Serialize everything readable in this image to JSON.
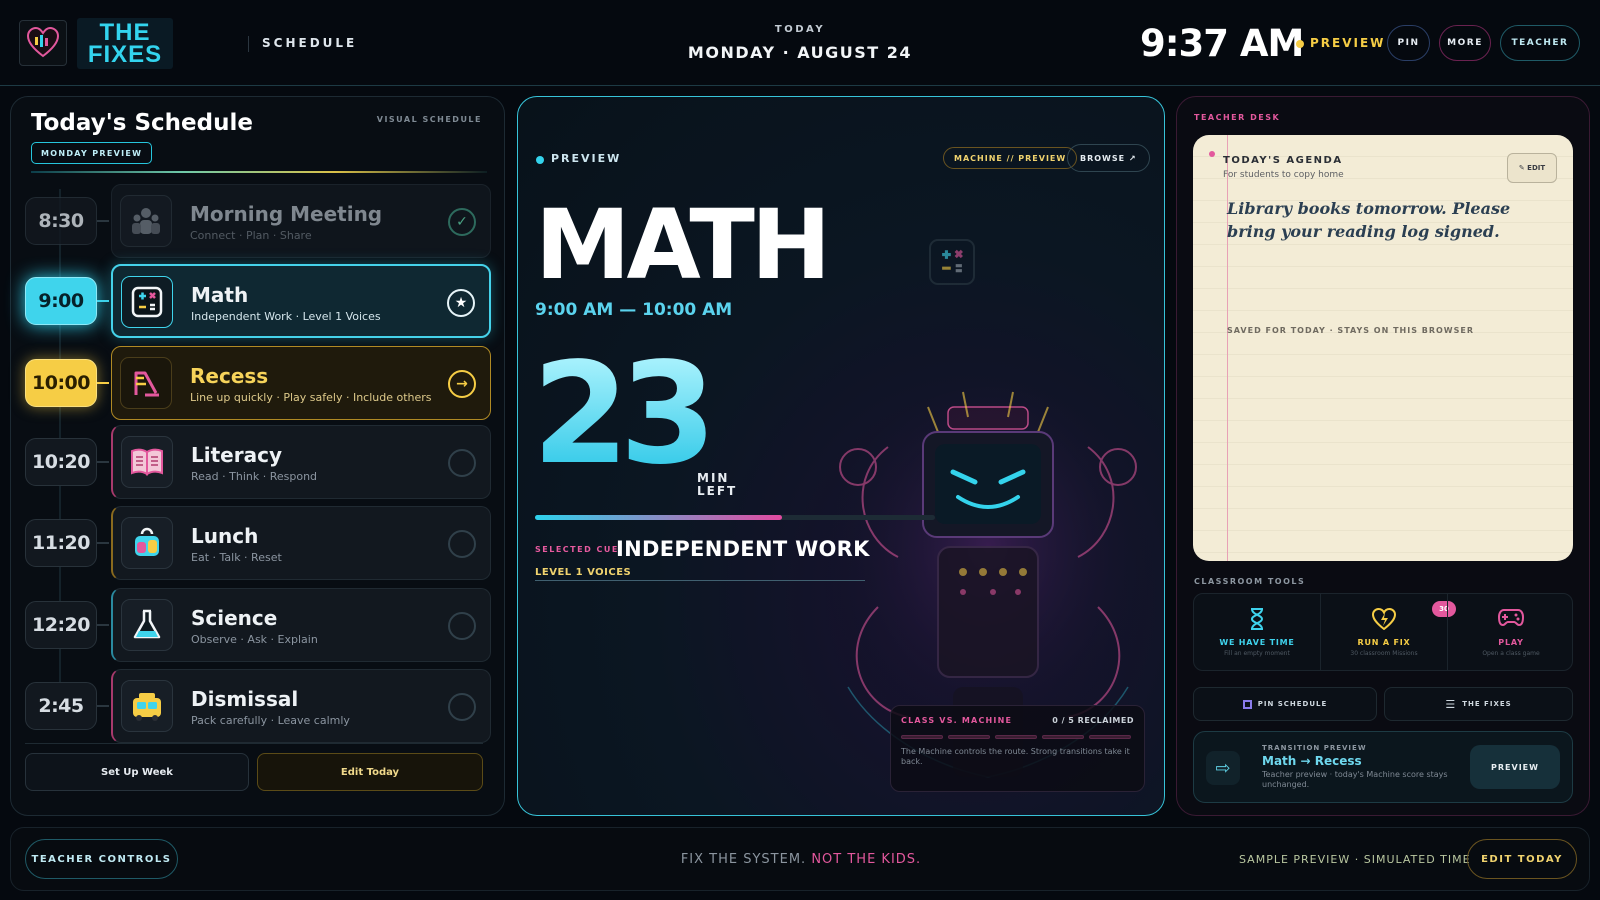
{
  "header": {
    "logo_line1": "THE",
    "logo_line2": "FIXES",
    "section": "SCHEDULE",
    "today_label": "TODAY",
    "date": "MONDAY · AUGUST 24",
    "clock": "9:37 AM",
    "preview_label": "PREVIEW",
    "buttons": {
      "pin": "PIN",
      "more": "MORE",
      "teacher": "TEACHER"
    }
  },
  "schedule": {
    "title": "Today's Schedule",
    "visual_label": "VISUAL SCHEDULE",
    "badge": "MONDAY PREVIEW",
    "items": [
      {
        "time": "8:30",
        "name": "Morning Meeting",
        "sub": "Connect · Plan · Share",
        "state": "done",
        "mark": "✓",
        "icon": "people-icon"
      },
      {
        "time": "9:00",
        "name": "Math",
        "sub": "Independent Work · Level 1 Voices",
        "state": "current",
        "mark": "★",
        "icon": "calculator-icon"
      },
      {
        "time": "10:00",
        "name": "Recess",
        "sub": "Line up quickly · Play safely · Include others",
        "state": "next",
        "mark": "→",
        "icon": "slide-icon"
      },
      {
        "time": "10:20",
        "name": "Literacy",
        "sub": "Read · Think · Respond",
        "state": "upcoming",
        "mark": "",
        "icon": "book-icon"
      },
      {
        "time": "11:20",
        "name": "Lunch",
        "sub": "Eat · Talk · Reset",
        "state": "upcoming",
        "mark": "",
        "icon": "lunchbox-icon"
      },
      {
        "time": "12:20",
        "name": "Science",
        "sub": "Observe · Ask · Explain",
        "state": "upcoming",
        "mark": "",
        "icon": "flask-icon"
      },
      {
        "time": "2:45",
        "name": "Dismissal",
        "sub": "Pack carefully · Leave calmly",
        "state": "upcoming",
        "mark": "",
        "icon": "bus-icon"
      }
    ],
    "setup_week": "Set Up Week",
    "edit_today": "Edit Today"
  },
  "current": {
    "preview_label": "PREVIEW",
    "machine_badge": "MACHINE // PREVIEW",
    "browse": "BROWSE ↗",
    "subject": "MATH",
    "time_range": "9:00 AM — 10:00 AM",
    "minutes_left": "23",
    "min_label_1": "MIN",
    "min_label_2": "LEFT",
    "progress_fraction": 0.617,
    "cue_label": "SELECTED CUE",
    "cue": "INDEPENDENT WORK",
    "voice_level": "LEVEL 1 VOICES",
    "class_vs_machine": {
      "title": "CLASS VS. MACHINE",
      "score": "0 / 5 RECLAIMED",
      "reclaimed": 0,
      "total": 5,
      "description": "The Machine controls the route. Strong transitions take it back."
    }
  },
  "teacher_desk": {
    "label": "TEACHER DESK",
    "agenda_title": "TODAY'S AGENDA",
    "agenda_sub": "For students to copy home",
    "edit": "✎ EDIT",
    "message": "Library books tomorrow. Please bring your reading log signed.",
    "saved": "SAVED FOR TODAY · STAYS ON THIS BROWSER",
    "tools_label": "CLASSROOM TOOLS",
    "tools": [
      {
        "title": "WE HAVE TIME",
        "sub": "Fill an empty moment",
        "icon": "hourglass-icon",
        "color": "#3fd2ec"
      },
      {
        "title": "RUN A FIX",
        "sub": "30 classroom Missions",
        "icon": "lightning-heart-icon",
        "color": "#f6cd45",
        "badge": "30"
      },
      {
        "title": "PLAY",
        "sub": "Open a class game",
        "icon": "gamepad-icon",
        "color": "#e3589d"
      }
    ],
    "pin_schedule": "PIN SCHEDULE",
    "the_fixes": "THE FIXES",
    "transition": {
      "label": "TRANSITION PREVIEW",
      "name": "Math → Recess",
      "desc": "Teacher preview · today's Machine score stays unchanged.",
      "button": "PREVIEW"
    }
  },
  "footer": {
    "teacher_controls": "TEACHER CONTROLS",
    "slogan_a": "FIX THE SYSTEM.",
    "slogan_b": "NOT THE KIDS.",
    "sample": "SAMPLE PREVIEW · SIMULATED TIME",
    "edit_today": "EDIT TODAY"
  },
  "colors": {
    "cyan": "#34d3ec",
    "pink": "#e3589d",
    "gold": "#f6cd45",
    "bg": "#05090f"
  }
}
